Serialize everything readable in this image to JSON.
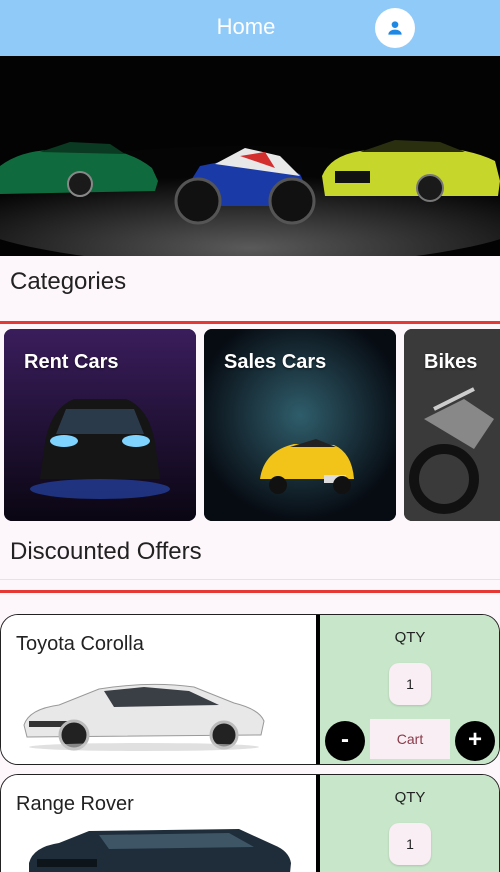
{
  "appbar": {
    "title": "Home",
    "profile_icon": "person-icon",
    "color": "#90caf9"
  },
  "sections": {
    "categories": "Categories",
    "discounted": "Discounted Offers"
  },
  "categories": [
    {
      "label": "Rent Cars"
    },
    {
      "label": "Sales Cars"
    },
    {
      "label": "Bikes"
    }
  ],
  "offers": [
    {
      "name": "Toyota Corolla",
      "qty_label": "QTY",
      "qty": "1",
      "cart_label": "Cart",
      "minus": "-",
      "plus": "+"
    },
    {
      "name": "Range Rover",
      "qty_label": "QTY",
      "qty": "1"
    }
  ],
  "colors": {
    "accent_red": "#e53935",
    "qty_panel": "#c8e6c9"
  }
}
